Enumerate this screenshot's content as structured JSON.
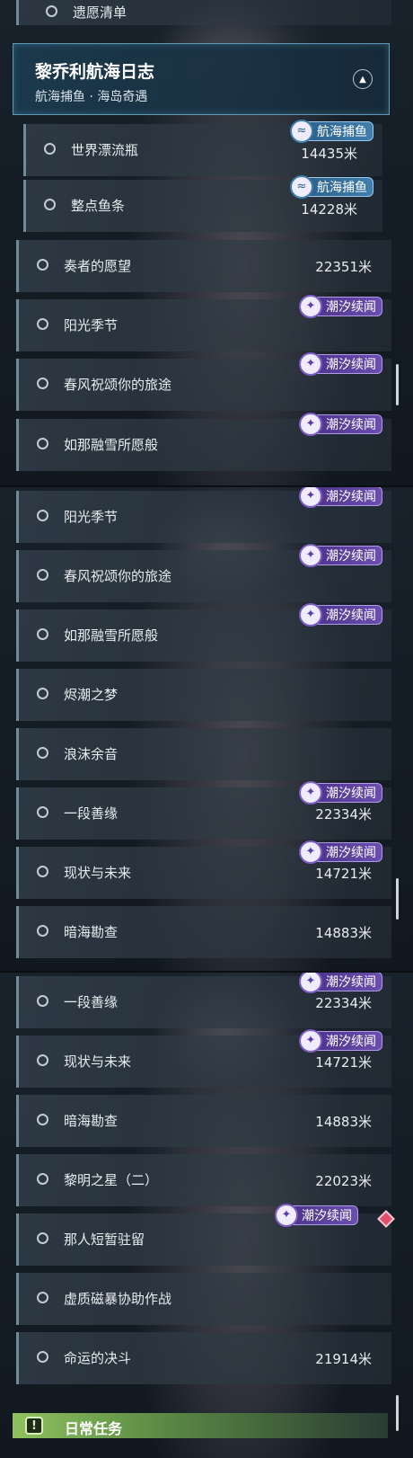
{
  "top_item": {
    "label": "遗愿清单"
  },
  "header": {
    "title": "黎乔利航海日志",
    "subtitle": "航海捕鱼 · 海岛奇遇",
    "collapse_icon": "▲"
  },
  "tags": {
    "fishing": "航海捕鱼",
    "tide": "潮汐续闻"
  },
  "panel1": {
    "rows": [
      {
        "label": "世界漂流瓶",
        "distance": "14435米"
      },
      {
        "label": "整点鱼条",
        "distance": "14228米"
      },
      {
        "label": "奏者的愿望",
        "distance": "22351米"
      },
      {
        "label": "阳光季节",
        "distance": ""
      },
      {
        "label": "春风祝颂你的旅途",
        "distance": ""
      },
      {
        "label": "如那融雪所愿般",
        "distance": ""
      }
    ]
  },
  "panel2": {
    "rows": [
      {
        "label": "阳光季节",
        "distance": ""
      },
      {
        "label": "春风祝颂你的旅途",
        "distance": ""
      },
      {
        "label": "如那融雪所愿般",
        "distance": ""
      },
      {
        "label": "烬潮之梦",
        "distance": ""
      },
      {
        "label": "浪沫余音",
        "distance": ""
      },
      {
        "label": "一段善缘",
        "distance": "22334米"
      },
      {
        "label": "现状与未来",
        "distance": "14721米"
      },
      {
        "label": "暗海勘查",
        "distance": "14883米"
      }
    ]
  },
  "panel3": {
    "rows": [
      {
        "label": "一段善缘",
        "distance": "22334米"
      },
      {
        "label": "现状与未来",
        "distance": "14721米"
      },
      {
        "label": "暗海勘查",
        "distance": "14883米"
      },
      {
        "label": "黎明之星（二）",
        "distance": "22023米"
      },
      {
        "label": "那人短暂驻留",
        "distance": ""
      },
      {
        "label": "虚质磁暴协助作战",
        "distance": ""
      },
      {
        "label": "命运的决斗",
        "distance": "21914米"
      }
    ]
  },
  "daily": {
    "icon_text": "!",
    "label": "日常任务"
  },
  "colors": {
    "accent_purple": "#6a4fb0",
    "accent_blue": "#3f7fae",
    "daily_green": "#8fc25f",
    "marker_red": "#e0506c"
  }
}
